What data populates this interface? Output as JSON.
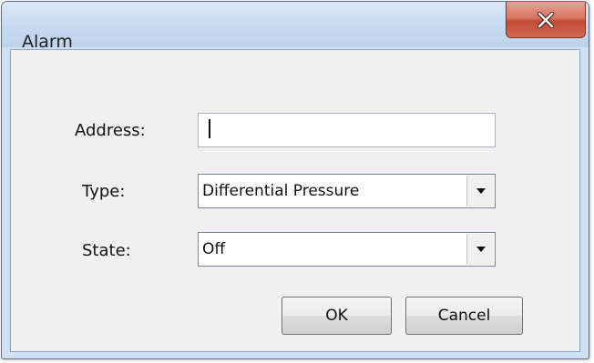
{
  "window": {
    "title": "Alarm",
    "close_icon": "close-x-icon"
  },
  "form": {
    "address_label": "Address:",
    "address_value": "",
    "type_label": "Type:",
    "type_value": "Differential Pressure",
    "state_label": "State:",
    "state_value": "Off",
    "dropdown_icon": "chevron-down-icon"
  },
  "buttons": {
    "ok_label": "OK",
    "cancel_label": "Cancel"
  },
  "colors": {
    "titlebar": "#cfe0f2",
    "close_button": "#c24b35",
    "client_background": "#f0f0f0"
  }
}
